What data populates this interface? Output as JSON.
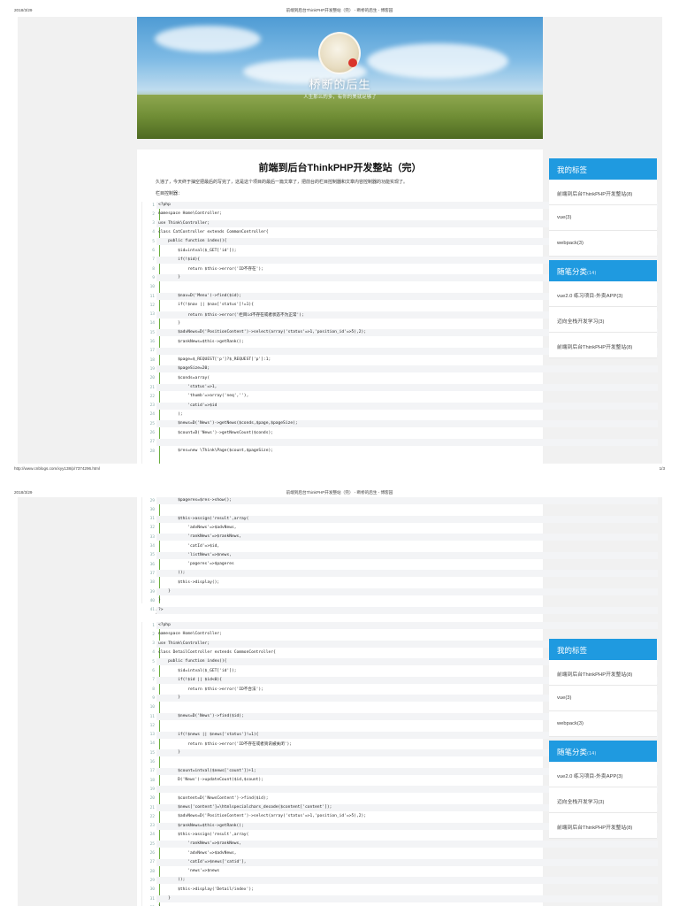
{
  "pages": [
    {
      "date": "2018/3/29",
      "title": "前端到后台ThinkPHP开发整站（完） - 断桥的后生 - 博客园",
      "url": "http://www.cnblogs.com/xyy138/p/7374296.html",
      "page_no": "1/3"
    },
    {
      "date": "2018/3/29",
      "title": "前端到后台ThinkPHP开发整站（完） - 断桥的后生 - 博客园"
    }
  ],
  "banner": {
    "title": "桥断的后生",
    "subtitle": "人生那么的多，有你的美就足够了"
  },
  "post": {
    "title": "前端到后台ThinkPHP开发整站（完）",
    "intro": "久违了，今天终于抽空把最后的写完了，这是这个项目的最后一篇文章了，把前台的栏目控制器和文章内容控制器的功能实现了。",
    "cat_label": "栏目控制器：",
    "detail_label": "文章内容控制器："
  },
  "code1": [
    "<?php",
    "namespace Home\\Controller;",
    "use Think\\Controller;",
    "class CatController extends CommonController{",
    "    public function index(){",
    "        $id=intval($_GET['id']);",
    "        if(!$id){",
    "            return $this->error('ID不存在');",
    "        }",
    "",
    "        $nav=D('Menu')->find($id);",
    "        if(!$nav || $nav['status']!=1){",
    "            return $this->error('栏目id不存在或者状态不为正常');",
    "        }",
    "        $advNews=D('PositionContent')->select(array('status'=>1,'position_id'=>5),2);",
    "        $rankNews=$this->getRank();",
    "",
    "        $page=$_REQUEST['p']?$_REQUEST['p']:1;",
    "        $pageSize=20;",
    "        $conds=array(",
    "            'status'=>1,",
    "            'thumb'=>array('neq',''),",
    "            'catid'=>$id",
    "        );",
    "        $news=D('News')->getNews($conds,$page,$pageSize);",
    "        $count=D('News')->getNewsCount($conds);",
    "",
    "        $res=new \\Think\\Page($count,$pageSize);",
    "        $pageres=$res->show();",
    "",
    "        $this->assign('result',array(",
    "            'advNews'=>$advNews,",
    "            'rankNews'=>$rankNews,",
    "            'catId'=>$id,",
    "            'listNews'=>$news,",
    "            'pageres'=>$pageres",
    "        ));",
    "        $this->display();",
    "    }",
    "}",
    "?>"
  ],
  "code2": [
    "<?php",
    "namespace Home\\Controller;",
    "use Think\\Controller;",
    "class DetailController extends CommonController{",
    "    public function index(){",
    "        $id=intval($_GET['id']);",
    "        if(!$id || $id<0){",
    "            return $this->error('ID不合法');",
    "        }",
    "",
    "        $news=D('News')->find($id);",
    "",
    "        if(!$news || $news['status']!=1){",
    "            return $this->error('ID不存在或者资讯被关闭');",
    "        }",
    "",
    "        $count=intval($news['count'])+1;",
    "        D('News')->updateCount($id,$count);",
    "",
    "        $content=D('NewsContent')->find($id);",
    "        $news['content']=\\htmlspecialchars_decode($content['content']);",
    "        $advNews=D('PositionContent')->select(array('status'=>1,'position_id'=>5),2);",
    "        $rankNews=$this->getRank();",
    "        $this->assign('result',array(",
    "            'rankNews'=>$rankNews,",
    "            'advNews'=>$advNews,",
    "            'catId'=>$news['catid'],",
    "            'news'=>$news",
    "        ));",
    "        $this->display('Detail/index');",
    "    }",
    "}"
  ],
  "sidebar": {
    "tags_title": "我的标签",
    "tags": [
      "前端到后台ThinkPHP开发整站(8)",
      "vue(3)",
      "webpack(3)"
    ],
    "cats_title": "随笔分类",
    "cats_count": "(14)",
    "cats": [
      "vue2.0 练习项目-外卖APP(3)",
      "迈向全栈开发学习(3)",
      "前端到后台ThinkPHP开发整站(8)"
    ]
  }
}
